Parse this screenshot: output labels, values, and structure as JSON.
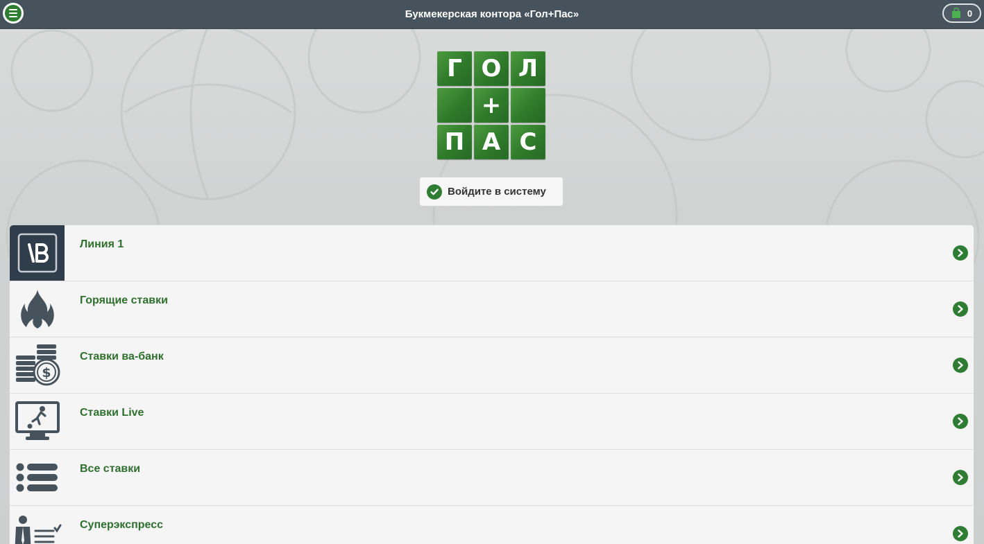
{
  "header": {
    "title": "Букмекерская контора «Гол+Пас»",
    "menu_icon": "hamburger-icon",
    "cart_icon": "shopping-bag-icon",
    "cart_count": "0"
  },
  "logo": {
    "tiles": [
      "Г",
      "О",
      "Л",
      "",
      "+",
      "",
      "П",
      "А",
      "С"
    ]
  },
  "login": {
    "label": "Войдите в систему",
    "icon": "check-circle-icon"
  },
  "menu": {
    "items": [
      {
        "label": "Линия 1",
        "icon": "line-b-icon"
      },
      {
        "label": "Горящие ставки",
        "icon": "fire-icon"
      },
      {
        "label": "Ставки ва-банк",
        "icon": "coins-dollar-icon"
      },
      {
        "label": "Ставки Live",
        "icon": "monitor-player-icon"
      },
      {
        "label": "Все ставки",
        "icon": "list-icon"
      },
      {
        "label": "Суперэкспресс",
        "icon": "person-checklist-icon"
      }
    ]
  },
  "colors": {
    "accent": "#2e7d32",
    "header_bg": "#47535c",
    "label_green": "#2e6f2d"
  }
}
